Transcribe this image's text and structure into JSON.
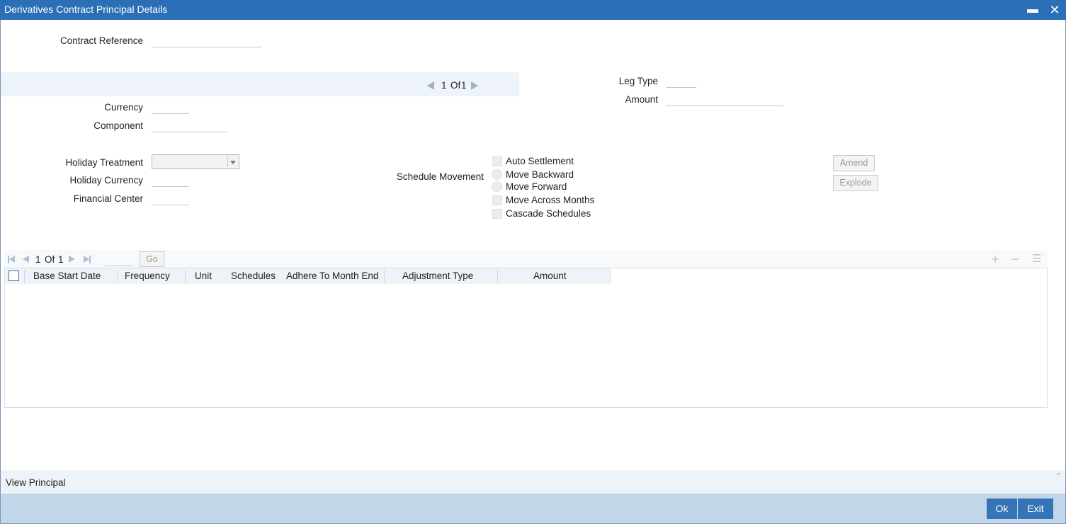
{
  "window": {
    "title": "Derivatives Contract Principal Details"
  },
  "contract": {
    "reference_label": "Contract Reference",
    "reference_value": ""
  },
  "leg_nav": {
    "page": "1",
    "of": "Of",
    "total": "1"
  },
  "leg": {
    "type_label": "Leg Type",
    "type_value": "",
    "amount_label": "Amount",
    "amount_value": ""
  },
  "principal": {
    "currency_label": "Currency",
    "currency_value": "",
    "component_label": "Component",
    "component_value": ""
  },
  "holiday": {
    "treatment_label": "Holiday Treatment",
    "treatment_value": "",
    "currency_label": "Holiday Currency",
    "currency_value": "",
    "center_label": "Financial Center",
    "center_value": ""
  },
  "schedule": {
    "movement_label": "Schedule Movement",
    "auto_settlement": "Auto Settlement",
    "move_backward": "Move Backward",
    "move_forward": "Move Forward",
    "move_across_months": "Move Across Months",
    "cascade_schedules": "Cascade Schedules"
  },
  "buttons": {
    "amend": "Amend",
    "explode": "Explode",
    "go": "Go",
    "ok": "Ok",
    "exit": "Exit"
  },
  "grid": {
    "page": "1",
    "of": "Of",
    "total": "1",
    "columns": [
      "Base Start Date",
      "Frequency",
      "Unit",
      "Schedules",
      "Adhere To Month End",
      "Adjustment Type",
      "Amount"
    ]
  },
  "footer": {
    "view_principal": "View Principal"
  }
}
